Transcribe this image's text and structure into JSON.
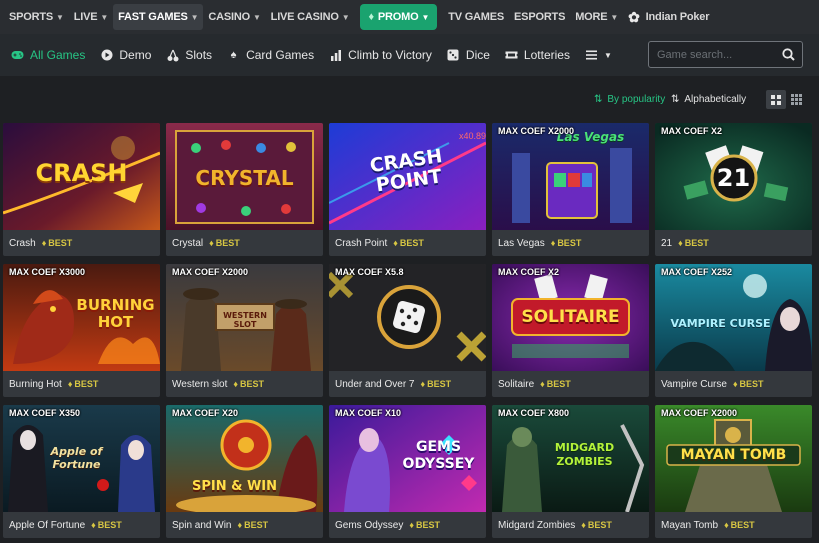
{
  "topnav": {
    "items": [
      {
        "label": "SPORTS",
        "chevron": true
      },
      {
        "label": "LIVE",
        "chevron": true
      },
      {
        "label": "FAST GAMES",
        "chevron": true,
        "active": true
      },
      {
        "label": "CASINO",
        "chevron": true
      },
      {
        "label": "LIVE CASINO",
        "chevron": true
      },
      {
        "label": "PROMO",
        "chevron": true
      },
      {
        "label": "TV GAMES",
        "chevron": false
      },
      {
        "label": "ESPORTS",
        "chevron": false
      },
      {
        "label": "MORE",
        "chevron": true
      },
      {
        "label": "Indian Poker",
        "chevron": false
      }
    ],
    "promo_color": "#1aa36f"
  },
  "categories": [
    {
      "label": "All Games",
      "icon": "gamepad-icon"
    },
    {
      "label": "Demo",
      "icon": "play-icon"
    },
    {
      "label": "Slots",
      "icon": "cherries-icon"
    },
    {
      "label": "Card Games",
      "icon": "spade-icon"
    },
    {
      "label": "Climb to Victory",
      "icon": "bar-chart-icon"
    },
    {
      "label": "Dice",
      "icon": "dice-icon"
    },
    {
      "label": "Lotteries",
      "icon": "ticket-icon"
    }
  ],
  "search": {
    "placeholder": "Game search..."
  },
  "sort": {
    "popularity": "By popularity",
    "alphabetical": "Alphabetically"
  },
  "accent": "#27c585",
  "best_label": "BEST",
  "games": [
    {
      "name": "Crash",
      "coef": "",
      "logo": "CRASH"
    },
    {
      "name": "Crystal",
      "coef": "",
      "logo": "CRYSTAL"
    },
    {
      "name": "Crash Point",
      "coef": "",
      "logo": "CRASH POINT"
    },
    {
      "name": "Las Vegas",
      "coef": "MAX COEF X2000",
      "logo": "Las Vegas"
    },
    {
      "name": "21",
      "coef": "MAX COEF X2",
      "logo": "21"
    },
    {
      "name": "Burning Hot",
      "coef": "MAX COEF X3000",
      "logo": "BURNING HOT"
    },
    {
      "name": "Western slot",
      "coef": "MAX COEF X2000",
      "logo": "WESTERN SLOT"
    },
    {
      "name": "Under and Over 7",
      "coef": "MAX COEF X5.8",
      "logo": ""
    },
    {
      "name": "Solitaire",
      "coef": "MAX COEF X2",
      "logo": "SOLITAIRE"
    },
    {
      "name": "Vampire Curse",
      "coef": "MAX COEF X252",
      "logo": "VAMPIRE CURSE"
    },
    {
      "name": "Apple Of Fortune",
      "coef": "MAX COEF X350",
      "logo": "Apple of Fortune"
    },
    {
      "name": "Spin and Win",
      "coef": "MAX COEF X20",
      "logo": "SPIN & WIN"
    },
    {
      "name": "Gems Odyssey",
      "coef": "MAX COEF X10",
      "logo": "GEMS ODYSSEY"
    },
    {
      "name": "Midgard Zombies",
      "coef": "MAX COEF X800",
      "logo": "MIDGARD ZOMBIES"
    },
    {
      "name": "Mayan Tomb",
      "coef": "MAX COEF X2000",
      "logo": "MAYAN TOMB"
    }
  ]
}
